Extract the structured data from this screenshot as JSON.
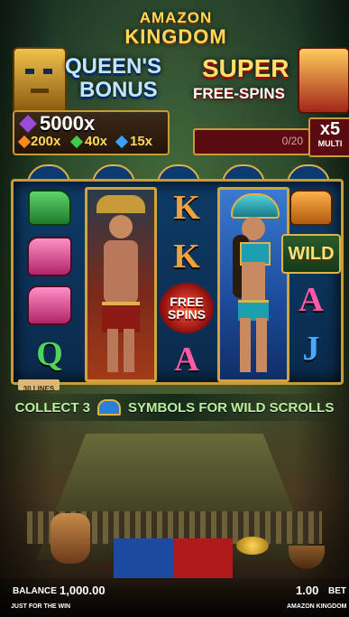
{
  "logo": {
    "line1": "AMAZON",
    "line2": "KINGDOM"
  },
  "queens_bonus": {
    "title_line1": "QUEEN'S",
    "title_line2": "BONUS",
    "max_multiplier": "5000x",
    "gems": [
      "200x",
      "40x",
      "15x"
    ]
  },
  "free_spins_meter": {
    "title_line1": "SUPER",
    "title_line2": "FREE-SPINS",
    "progress_text": "0/20",
    "multiplier": "x5",
    "multiplier_label": "MULTI",
    "progress": 0
  },
  "reels": {
    "col1": [
      "mask-green-icon",
      "mask-pink-icon",
      "mask-pink-icon",
      "Q"
    ],
    "col3": [
      "K",
      "K",
      "FREE SPINS",
      "A"
    ],
    "col5": [
      "mask-orange-icon",
      "WILD",
      "A",
      "J"
    ],
    "lines_label": "30 LINES"
  },
  "info_banner": {
    "left": "COLLECT 3",
    "right": "SYMBOLS FOR WILD SCROLLS"
  },
  "footer": {
    "balance_label": "BALANCE",
    "balance_value": "1,000.00",
    "bet_value": "1.00",
    "bet_label": "BET",
    "provider": "JUST FOR THE WIN",
    "game_name": "AMAZON KINGDOM"
  },
  "colors": {
    "gold": "#d4a33c",
    "reel_bg": "#0d3b66",
    "red_panel": "#7a0c14"
  }
}
